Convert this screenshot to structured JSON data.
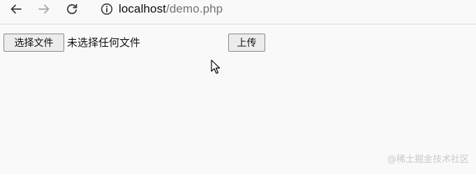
{
  "toolbar": {
    "back_icon": "arrow-left-icon",
    "forward_icon": "arrow-right-icon",
    "reload_icon": "reload-icon",
    "info_icon": "info-icon",
    "url_host": "localhost",
    "url_path": "/demo.php"
  },
  "form": {
    "choose_file_label": "选择文件",
    "file_status": "未选择任何文件",
    "upload_label": "上传"
  },
  "overlay": {
    "cursor_icon": "mouse-cursor-icon",
    "watermark": "@稀土掘金技术社区"
  }
}
